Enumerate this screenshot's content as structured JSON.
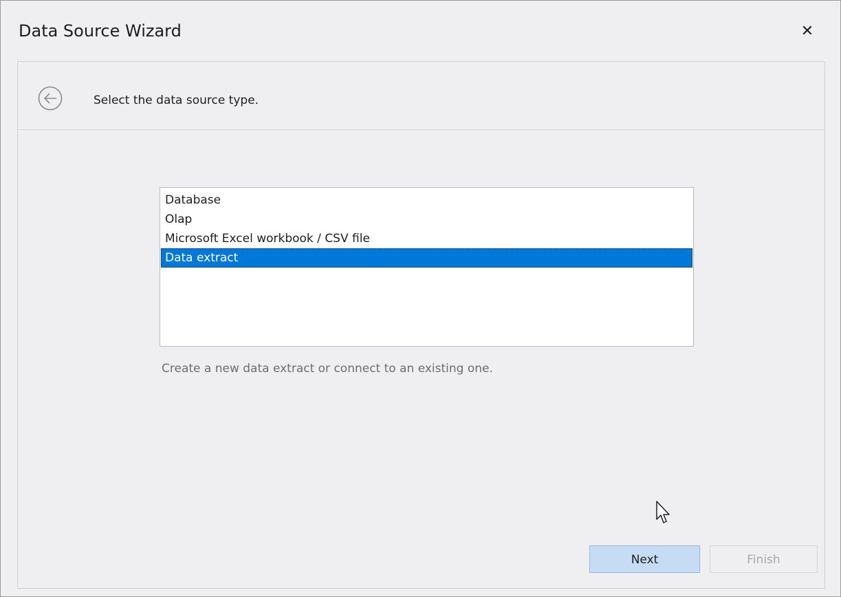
{
  "window": {
    "title": "Data Source Wizard",
    "close_glyph": "✕"
  },
  "header": {
    "back_icon": "back-arrow-circle-icon",
    "instruction": "Select the data source type."
  },
  "source_types": {
    "items": [
      {
        "label": "Database",
        "selected": false
      },
      {
        "label": "Olap",
        "selected": false
      },
      {
        "label": "Microsoft Excel workbook / CSV file",
        "selected": false
      },
      {
        "label": "Data extract",
        "selected": true
      }
    ],
    "description": "Create a new data extract or connect to an existing one."
  },
  "footer": {
    "next_label": "Next",
    "finish_label": "Finish",
    "finish_enabled": false
  },
  "colors": {
    "selection": "#0078d7",
    "window_bg": "#efeff2",
    "next_bg": "#c6dcf4"
  }
}
